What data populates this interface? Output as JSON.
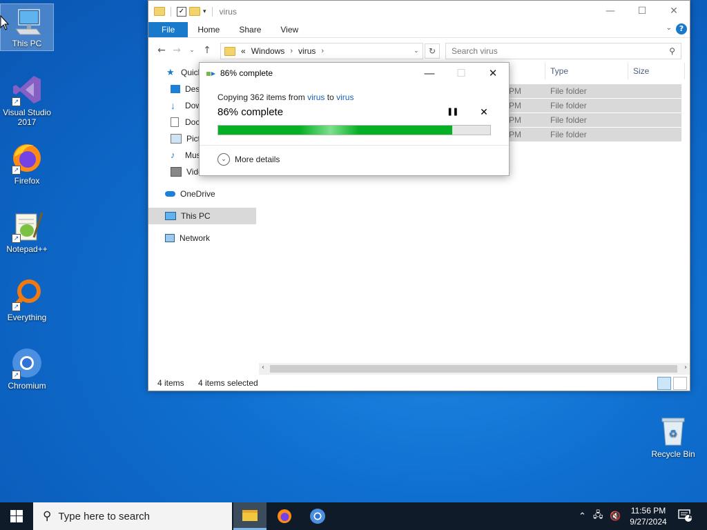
{
  "desktop": {
    "icons": [
      {
        "label": "This PC"
      },
      {
        "label": "Visual Studio 2017"
      },
      {
        "label": "Firefox"
      },
      {
        "label": "Notepad++"
      },
      {
        "label": "Everything"
      },
      {
        "label": "Chromium"
      },
      {
        "label": "Recycle Bin"
      }
    ]
  },
  "explorer": {
    "title": "virus",
    "ribbon_tabs": [
      "File",
      "Home",
      "Share",
      "View"
    ],
    "help": "?",
    "address": {
      "prefix": "«",
      "segments": [
        "Windows",
        "virus"
      ]
    },
    "search_placeholder": "Search virus",
    "nav_items": [
      "Quick access",
      "Desktop",
      "Downloads",
      "Documents",
      "Pictures",
      "Music",
      "Videos",
      "OneDrive",
      "This PC",
      "Network"
    ],
    "nav_visible": [
      "Quick",
      "Desk",
      "Dow",
      "Doc",
      "Pict",
      "Mus",
      "Videos",
      "OneDrive",
      "This PC",
      "Network"
    ],
    "columns": {
      "type": "Type",
      "size": "Size"
    },
    "rows": [
      {
        "time_suffix": "PM",
        "type": "File folder"
      },
      {
        "time_suffix": "PM",
        "type": "File folder"
      },
      {
        "time_suffix": "PM",
        "type": "File folder"
      },
      {
        "time_suffix": "PM",
        "type": "File folder"
      }
    ],
    "status": {
      "items": "4 items",
      "selected": "4 items selected"
    }
  },
  "copy_dialog": {
    "title": "86% complete",
    "line_prefix": "Copying 362 items from",
    "source": "virus",
    "middle": "to",
    "dest": "virus",
    "progress_text": "86% complete",
    "progress": 0.86,
    "more_details": "More details"
  },
  "taskbar": {
    "search_placeholder": "Type here to search",
    "time": "11:56 PM",
    "date": "9/27/2024",
    "notif_count": "1"
  },
  "colors": {
    "accent": "#1979ca",
    "progress": "#06b025",
    "taskbar": "#101b2a"
  }
}
